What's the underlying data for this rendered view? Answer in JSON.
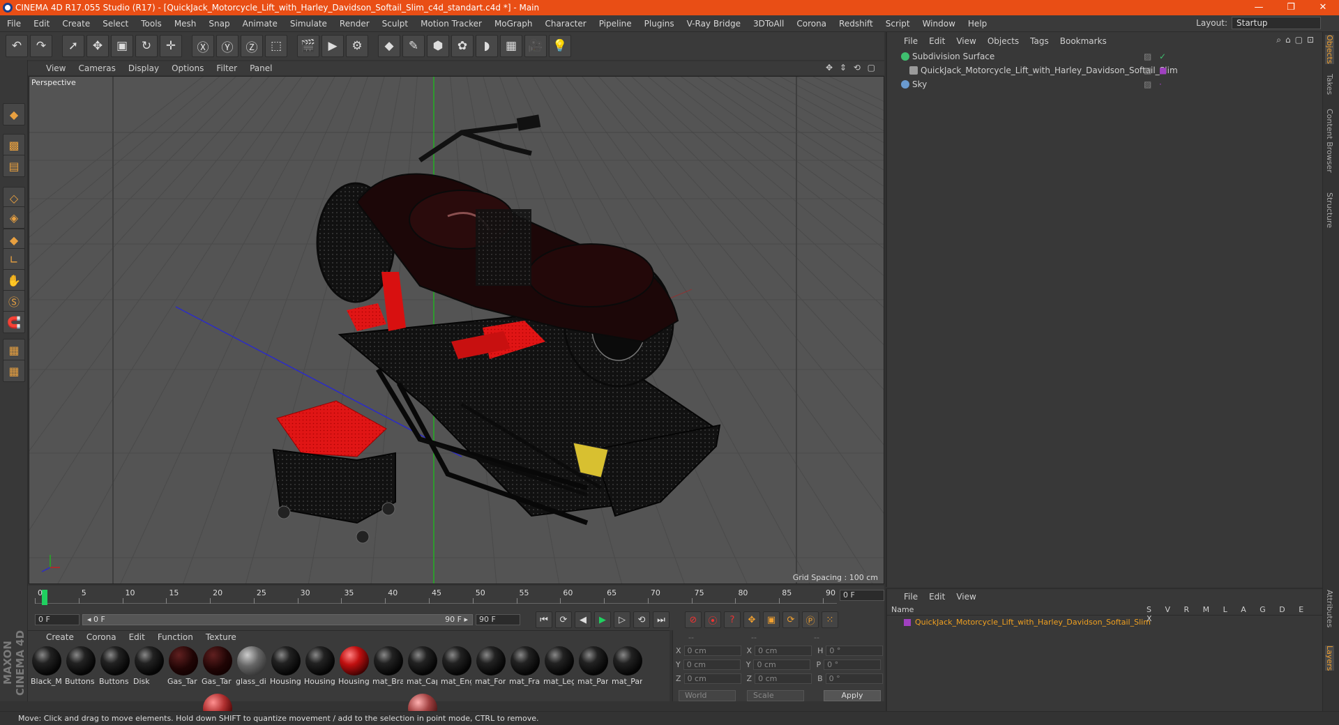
{
  "window": {
    "title": "CINEMA 4D R17.055 Studio (R17) - [QuickJack_Motorcycle_Lift_with_Harley_Davidson_Softail_Slim_c4d_standart.c4d *] - Main",
    "controls": [
      "—",
      "❐",
      "✕"
    ]
  },
  "menu": [
    "File",
    "Edit",
    "Create",
    "Select",
    "Tools",
    "Mesh",
    "Snap",
    "Animate",
    "Simulate",
    "Render",
    "Sculpt",
    "Motion Tracker",
    "MoGraph",
    "Character",
    "Pipeline",
    "Plugins",
    "V-Ray Bridge",
    "3DToAll",
    "Corona",
    "Redshift",
    "Script",
    "Window",
    "Help"
  ],
  "layout": {
    "label": "Layout:",
    "value": "Startup"
  },
  "toolbar": [
    {
      "name": "undo-icon",
      "glyph": "↶"
    },
    {
      "name": "redo-icon",
      "glyph": "↷"
    },
    {
      "name": "sep"
    },
    {
      "name": "live-select-icon",
      "glyph": "➚"
    },
    {
      "name": "move-icon",
      "glyph": "✥"
    },
    {
      "name": "scale-icon",
      "glyph": "▣"
    },
    {
      "name": "rotate-icon",
      "glyph": "↻"
    },
    {
      "name": "move-alt-icon",
      "glyph": "✛"
    },
    {
      "name": "sep"
    },
    {
      "name": "x-axis-icon",
      "glyph": "Ⓧ"
    },
    {
      "name": "y-axis-icon",
      "glyph": "Ⓨ"
    },
    {
      "name": "z-axis-icon",
      "glyph": "Ⓩ"
    },
    {
      "name": "world-coord-icon",
      "glyph": "⬚"
    },
    {
      "name": "sep"
    },
    {
      "name": "render-view-icon",
      "glyph": "🎬"
    },
    {
      "name": "render-pv-icon",
      "glyph": "▶"
    },
    {
      "name": "render-settings-icon",
      "glyph": "⚙"
    },
    {
      "name": "sep"
    },
    {
      "name": "cube-icon",
      "glyph": "◆"
    },
    {
      "name": "spline-pen-icon",
      "glyph": "✎"
    },
    {
      "name": "subdivision-icon",
      "glyph": "⬢"
    },
    {
      "name": "mograph-icon",
      "glyph": "✿"
    },
    {
      "name": "deformer-icon",
      "glyph": "◗"
    },
    {
      "name": "floor-icon",
      "glyph": "▦"
    },
    {
      "name": "camera-icon",
      "glyph": "🎥"
    },
    {
      "name": "light-icon",
      "glyph": "💡"
    }
  ],
  "left_tools": [
    "model-mode-icon",
    "texture-mode-icon",
    "workplane-icon",
    "points-mode-icon",
    "edges-mode-icon",
    "polygons-mode-icon",
    "axis-mode-icon",
    "tweak-mode-icon",
    "snap-s-icon",
    "magnet-icon",
    "lock-grid-icon",
    "grid-snap-icon"
  ],
  "viewport": {
    "menu": [
      "View",
      "Cameras",
      "Display",
      "Options",
      "Filter",
      "Panel"
    ],
    "icons": "✥ ⇕ ⟲ ▢",
    "camera_label": "Perspective",
    "grid_spacing": "Grid Spacing : 100 cm"
  },
  "timeline": {
    "ticks": [
      "0",
      "5",
      "10",
      "15",
      "20",
      "25",
      "30",
      "35",
      "40",
      "45",
      "50",
      "55",
      "60",
      "65",
      "70",
      "75",
      "80",
      "85",
      "90"
    ],
    "current_frame": "0 F",
    "start": "0 F",
    "range_start": "◂ 0 F",
    "range_end": "90 F ▸",
    "end": "90 F"
  },
  "transport": [
    "⏮",
    "⟳",
    "◀",
    "▶",
    "▷",
    "⟲",
    "⏭"
  ],
  "anim_buttons": [
    "⊘",
    "⦿",
    "?",
    "✥",
    "▣",
    "⟳",
    "Ⓟ",
    "⁙"
  ],
  "materials": {
    "menu": [
      "Create",
      "Corona",
      "Edit",
      "Function",
      "Texture"
    ],
    "row1": [
      "Black_M",
      "Buttons",
      "Buttons",
      "Disk",
      "Gas_Tar",
      "Gas_Tar",
      "glass_di",
      "Housing",
      "Housing",
      "Housing",
      "mat_Bra",
      "mat_Cap",
      "mat_Eng",
      "mat_For",
      "mat_Fra",
      "mat_Leg",
      "mat_Par",
      "mat_Par"
    ]
  },
  "coords": {
    "headers": [
      "--",
      "--",
      "--"
    ],
    "rows": [
      {
        "a": "X",
        "av": "0 cm",
        "b": "X",
        "bv": "0 cm",
        "c": "H",
        "cv": "0 °"
      },
      {
        "a": "Y",
        "av": "0 cm",
        "b": "Y",
        "bv": "0 cm",
        "c": "P",
        "cv": "0 °"
      },
      {
        "a": "Z",
        "av": "0 cm",
        "b": "Z",
        "bv": "0 cm",
        "c": "B",
        "cv": "0 °"
      }
    ],
    "space": "World",
    "mode": "Scale",
    "apply": "Apply"
  },
  "objects": {
    "menu": [
      "File",
      "Edit",
      "View",
      "Objects",
      "Tags",
      "Bookmarks"
    ],
    "items": [
      {
        "name": "Subdivision Surface",
        "color": "#3fbf6f"
      },
      {
        "name": "QuickJack_Motorcycle_Lift_with_Harley_Davidson_Softail_Slim",
        "color": "#9a9a9a"
      },
      {
        "name": "Sky",
        "color": "#6a9acf"
      }
    ]
  },
  "layers": {
    "menu": [
      "File",
      "Edit",
      "View"
    ],
    "header_name": "Name",
    "header_cols": "S V R M L A G D E X",
    "row_name": "QuickJack_Motorcycle_Lift_with_Harley_Davidson_Softail_Slim",
    "row_color": "#a040c0"
  },
  "right_tabs": [
    "Objects",
    "Takes",
    "Content Browser",
    "Structure",
    "Attributes",
    "Layers"
  ],
  "status": "Move: Click and drag to move elements. Hold down SHIFT to quantize movement / add to the selection in point mode, CTRL to remove.",
  "logo": "MAXON CINEMA 4D"
}
